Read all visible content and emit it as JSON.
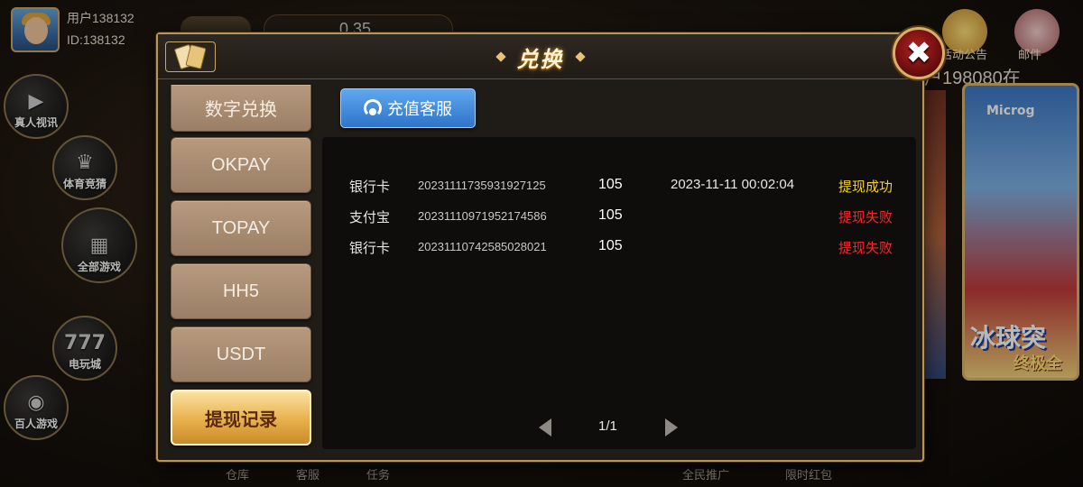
{
  "lobby": {
    "user_name": "用户138132",
    "user_id": "ID:138132",
    "balance": "0.35",
    "announcement_label": "活动公告",
    "mail_label": "邮件",
    "marquee_text": "户198080在",
    "side_menu": [
      {
        "label": "真人视讯",
        "icon": "video-camera-icon"
      },
      {
        "label": "体育竞猜",
        "icon": "trophy-icon"
      },
      {
        "label": "全部游戏",
        "icon": "grid-icon"
      },
      {
        "label": "电玩城",
        "icon": "slot-777-icon"
      },
      {
        "label": "百人游戏",
        "icon": "poker-chip-icon"
      }
    ],
    "promo": {
      "brand": "Microg",
      "title": "冰球突",
      "subtitle": "终极全"
    },
    "bottom_nav": [
      "仓库",
      "客服",
      "任务",
      "全民推广",
      "限时红包"
    ]
  },
  "modal": {
    "title": "兑换",
    "close_glyph": "✖",
    "categories": [
      {
        "label": "数字兑换",
        "active": false
      },
      {
        "label": "OKPAY",
        "active": false
      },
      {
        "label": "TOPAY",
        "active": false
      },
      {
        "label": "HH5",
        "active": false
      },
      {
        "label": "USDT",
        "active": false
      },
      {
        "label": "提现记录",
        "active": true
      }
    ],
    "service_button": "充值客服",
    "records": [
      {
        "method": "银行卡",
        "order_id": "20231111735931927125",
        "amount": "105",
        "time": "2023-11-11  00:02:04",
        "status": "提现成功",
        "status_type": "success"
      },
      {
        "method": "支付宝",
        "order_id": "20231110971952174586",
        "amount": "105",
        "time": "",
        "status": "提现失败",
        "status_type": "fail"
      },
      {
        "method": "银行卡",
        "order_id": "20231110742585028021",
        "amount": "105",
        "time": "",
        "status": "提现失败",
        "status_type": "fail"
      }
    ],
    "pagination": {
      "label": "1/1"
    }
  },
  "colors": {
    "success": "#f2d12a",
    "fail": "#ee2a2a",
    "gold_border": "#b9955a",
    "active_tab": "#e7b04b",
    "service_blue": "#2e74c9"
  }
}
